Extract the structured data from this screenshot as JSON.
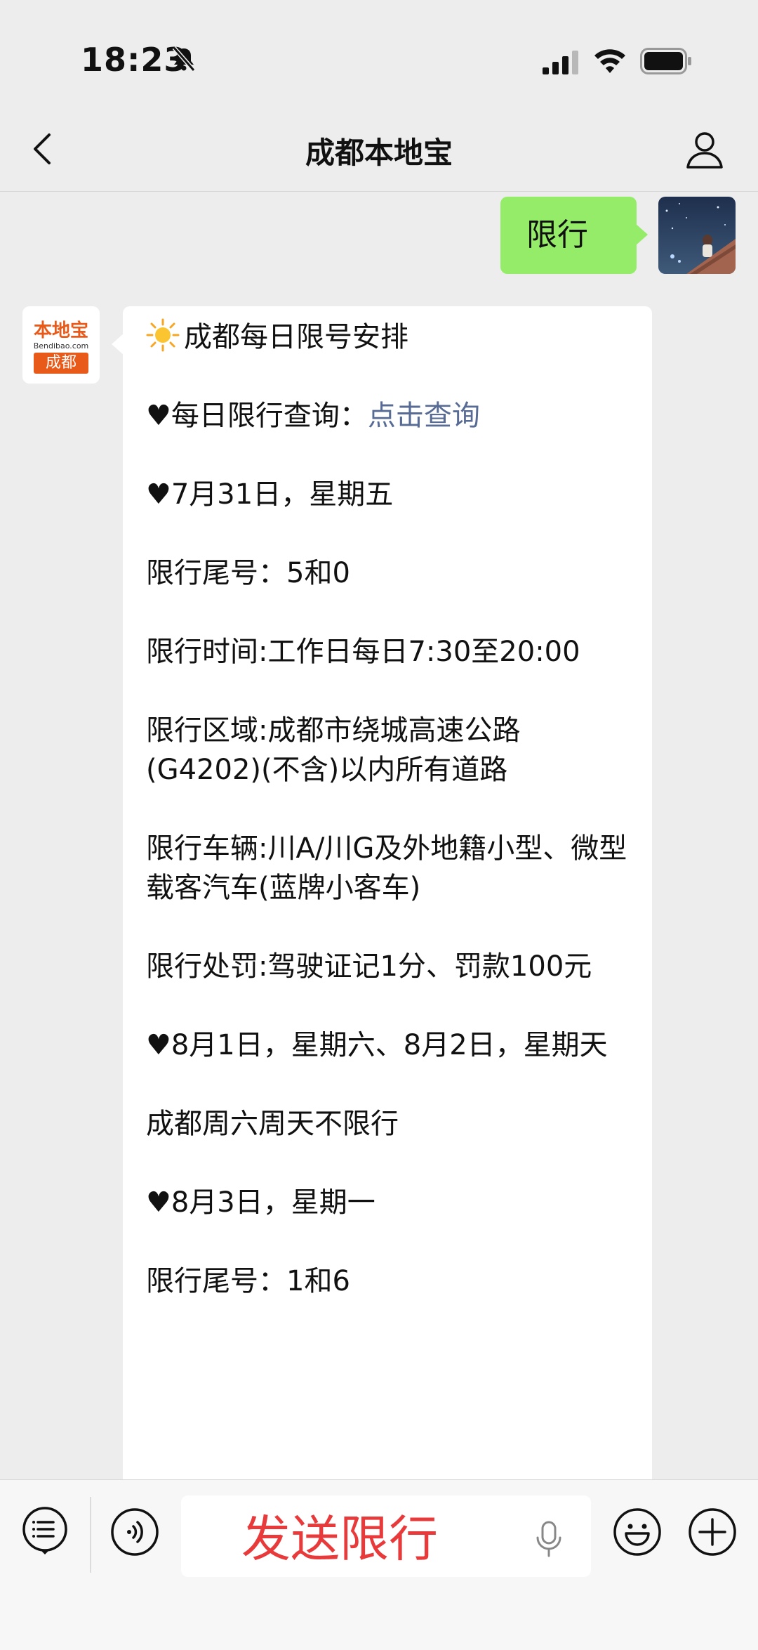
{
  "status_bar": {
    "time": "18:23"
  },
  "nav": {
    "title": "成都本地宝"
  },
  "outgoing": {
    "text": "限行"
  },
  "bot": {
    "logo_top": "本地宝",
    "logo_url": "Bendibao.com",
    "logo_city": "成都"
  },
  "message": {
    "title": "成都每日限号安排",
    "query_label": "♥每日限行查询：",
    "query_link": "点击查询",
    "jul31_header": "♥7月31日，星期五",
    "jul31_tail": "限行尾号：5和0",
    "time_rule": "限行时间:工作日每日7:30至20:00",
    "area_rule": "限行区域:成都市绕城高速公路(G4202)(不含)以内所有道路",
    "vehicle_rule": "限行车辆:川A/川G及外地籍小型、微型载客汽车(蓝牌小客车)",
    "penalty_rule": "限行处罚:驾驶证记1分、罚款100元",
    "aug12_header": "♥8月1日，星期六、8月2日，星期天",
    "weekend_note": "成都周六周天不限行",
    "aug3_header": "♥8月3日，星期一",
    "aug3_tail": "限行尾号：1和6"
  },
  "input": {
    "text": "发送限行"
  },
  "colors": {
    "outgoing_bubble": "#95ec69",
    "link": "#576b95",
    "input_text": "#e83a3a",
    "brand_orange": "#e85a1a"
  }
}
